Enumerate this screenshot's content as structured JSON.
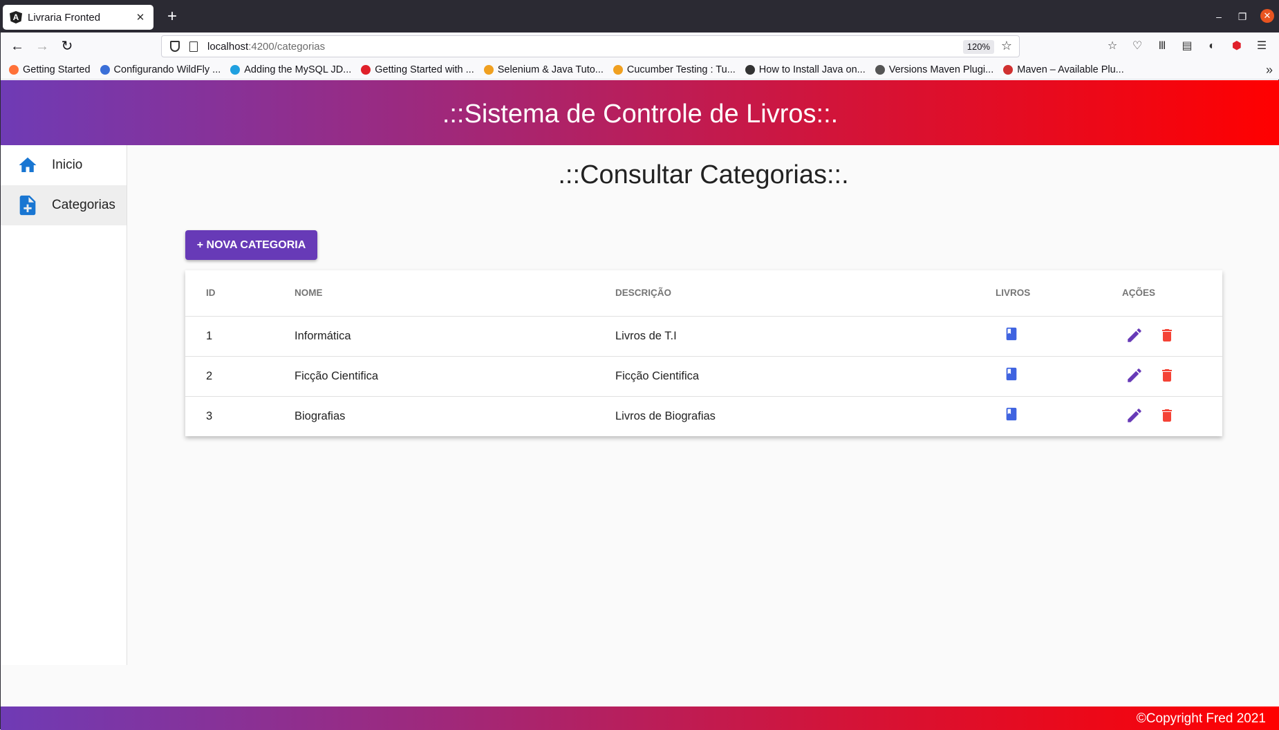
{
  "browser": {
    "tab_title": "Livraria Fronted",
    "url_host": "localhost",
    "url_path": ":4200/categorias",
    "zoom": "120%",
    "bookmarks": [
      {
        "label": "Getting Started",
        "color": "#ff7139"
      },
      {
        "label": "Configurando WildFly ...",
        "color": "#3b6fd8"
      },
      {
        "label": "Adding the MySQL JD...",
        "color": "#20a0e0"
      },
      {
        "label": "Getting Started with ...",
        "color": "#e0202a"
      },
      {
        "label": "Selenium & Java Tuto...",
        "color": "#f0a020"
      },
      {
        "label": "Cucumber Testing : Tu...",
        "color": "#f0a020"
      },
      {
        "label": "How to Install Java on...",
        "color": "#333333"
      },
      {
        "label": "Versions Maven Plugi...",
        "color": "#555555"
      },
      {
        "label": "Maven – Available Plu...",
        "color": "#d03030"
      }
    ]
  },
  "header": {
    "title": ".::Sistema de Controle de Livros::."
  },
  "sidebar": {
    "items": [
      {
        "label": "Inicio",
        "icon": "home-icon"
      },
      {
        "label": "Categorias",
        "icon": "note-add-icon"
      }
    ]
  },
  "main": {
    "title": ".::Consultar Categorias::.",
    "new_button": "+ NOVA CATEGORIA",
    "columns": [
      "ID",
      "NOME",
      "DESCRIÇÃO",
      "LIVROS",
      "AÇÕES"
    ],
    "rows": [
      {
        "id": "1",
        "nome": "Informática",
        "descricao": "Livros de T.I"
      },
      {
        "id": "2",
        "nome": "Ficção Cientifica",
        "descricao": "Ficção Cientifica"
      },
      {
        "id": "3",
        "nome": "Biografias",
        "descricao": "Livros de Biografias"
      }
    ]
  },
  "footer": {
    "text": "©Copyright Fred 2021"
  },
  "colors": {
    "primary": "#673ab7",
    "accent_red": "#f44336",
    "book_blue": "#3f63e0",
    "icon_blue": "#1976d2"
  }
}
